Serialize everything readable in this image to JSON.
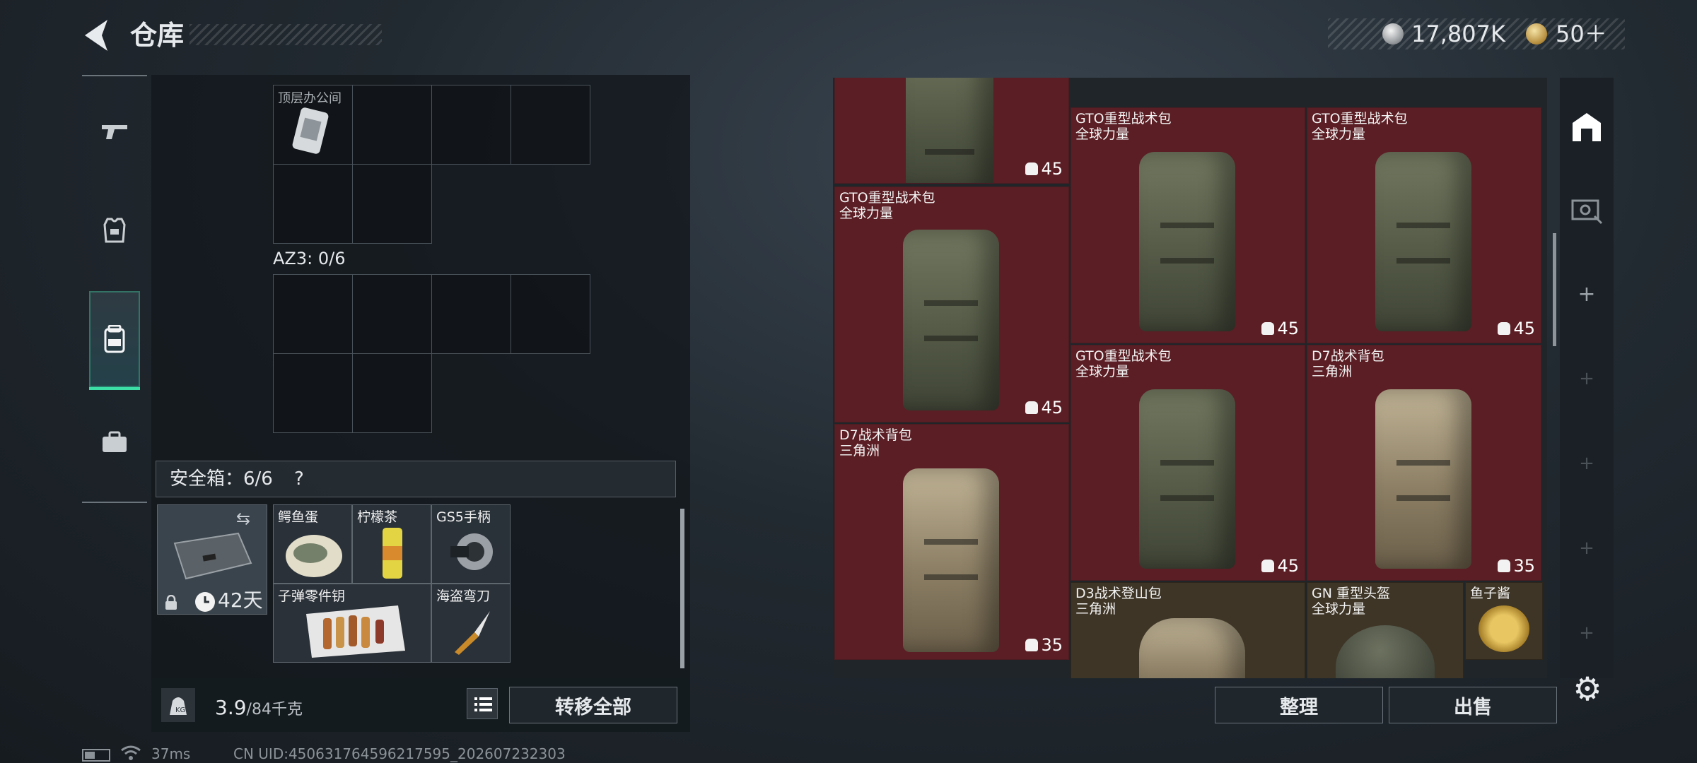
{
  "header": {
    "title": "仓库",
    "money": "17,807K",
    "coupons": "50＋"
  },
  "left_panel": {
    "top_grid_label": "顶层办公间",
    "az3_label": "AZ3: 0/6",
    "safe_box": {
      "label": "安全箱：6/6",
      "help": "?",
      "days": "42天",
      "items": [
        {
          "name": "鳄鱼蛋"
        },
        {
          "name": "柠檬茶"
        },
        {
          "name": "GS5手柄"
        },
        {
          "name": "子弹零件钥"
        },
        {
          "name": "海盗弯刀"
        }
      ]
    },
    "weight": {
      "current": "3.9",
      "max": "/84千克"
    },
    "transfer_all": "转移全部"
  },
  "stash": {
    "items": [
      {
        "n1": "",
        "n2": "",
        "qty": "45"
      },
      {
        "n1": "",
        "n2": "",
        "qty": "45"
      },
      {
        "n1": "",
        "n2": "",
        "qty": "45"
      },
      {
        "n1": "GTO重型战术包",
        "n2": "全球力量",
        "qty": "45"
      },
      {
        "n1": "GTO重型战术包",
        "n2": "全球力量",
        "qty": "45"
      },
      {
        "n1": "GTO重型战术包",
        "n2": "全球力量",
        "qty": "45"
      },
      {
        "n1": "GTO重型战术包",
        "n2": "全球力量",
        "qty": "45"
      },
      {
        "n1": "D7战术背包",
        "n2": "三角洲",
        "qty": "35"
      },
      {
        "n1": "D7战术背包",
        "n2": "三角洲",
        "qty": "35"
      },
      {
        "n1": "D3战术登山包",
        "n2": "三角洲",
        "qty": ""
      },
      {
        "n1": "GN 重型头盔",
        "n2": "全球力量",
        "qty": ""
      },
      {
        "n1": "鱼子酱",
        "n2": "",
        "qty": ""
      }
    ],
    "sort_label": "整理",
    "sell_label": "出售"
  },
  "status": {
    "ping": "37ms",
    "uid": "CN UID:450631764596217595_202607232303"
  },
  "colors": {
    "accent": "#3ce0a6",
    "stash_cell": "#5a1e24"
  }
}
